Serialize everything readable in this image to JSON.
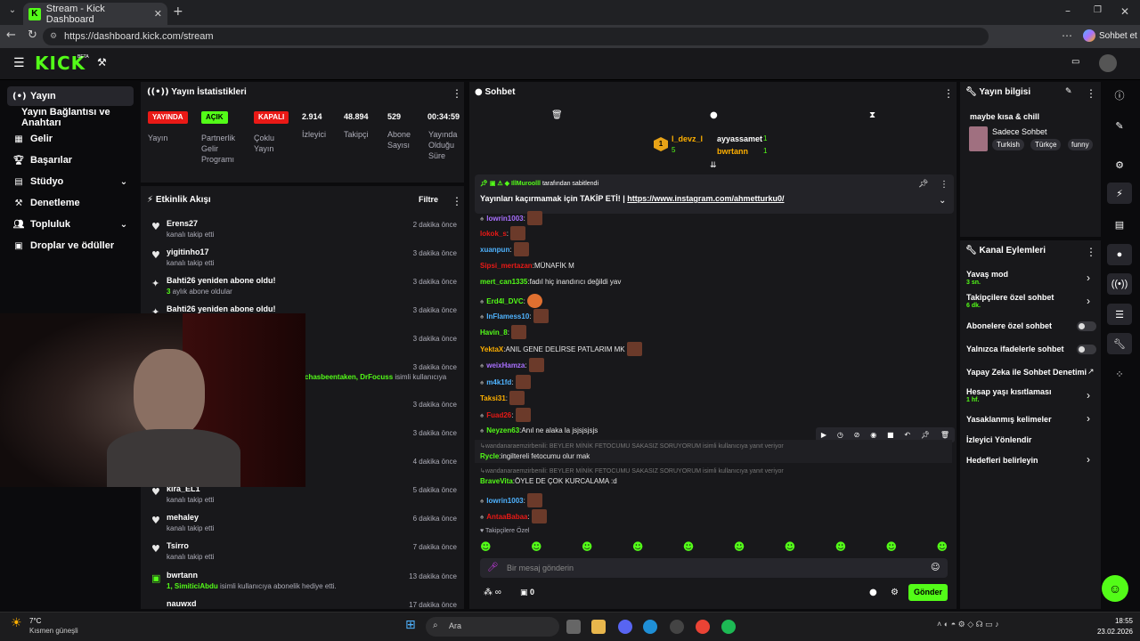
{
  "browser": {
    "tab_title": "Stream - Kick Dashboard",
    "url": "https://dashboard.kick.com/stream",
    "profile_label": "Sohbet et"
  },
  "header": {
    "logo": "KICK",
    "beta": "BETA"
  },
  "nav": {
    "items": [
      {
        "label": "Yayın",
        "icon": "broadcast-icon"
      },
      {
        "label": "Yayın Bağlantısı ve Anahtarı",
        "icon": ""
      },
      {
        "label": "Gelir",
        "icon": "revenue-icon"
      },
      {
        "label": "Başarılar",
        "icon": "trophy-icon"
      },
      {
        "label": "Stüdyo",
        "icon": "studio-icon"
      },
      {
        "label": "Denetleme",
        "icon": "moderation-icon"
      },
      {
        "label": "Topluluk",
        "icon": "community-icon"
      },
      {
        "label": "Droplar ve ödüller",
        "icon": "drops-icon"
      }
    ]
  },
  "stats": {
    "title": "Yayın İstatistikleri",
    "badges": [
      {
        "text": "YAYINDA",
        "label": "Yayın",
        "color": "#e91916"
      },
      {
        "text": "AÇIK",
        "label": "Partnerlik Gelir Programı",
        "color": "#53fc18"
      },
      {
        "text": "KAPALI",
        "label": "Çoklu Yayın",
        "color": "#e91916"
      }
    ],
    "values": [
      {
        "v": "2.914",
        "l": "İzleyici"
      },
      {
        "v": "48.894",
        "l": "Takipçi"
      },
      {
        "v": "529",
        "l": "Abone Sayısı"
      },
      {
        "v": "00:34:59",
        "l": "Yayında Olduğu Süre"
      }
    ]
  },
  "activity": {
    "title": "Etkinlik Akışı",
    "filter": "Filtre",
    "items": [
      {
        "name": "Erens27",
        "sub": "kanalı takip etti",
        "time": "2 dakika önce"
      },
      {
        "name": "yigitinho17",
        "sub": "kanalı takip etti",
        "time": "3 dakika önce"
      },
      {
        "name": "Bahti26 yeniden abone oldu!",
        "sub_num": "3",
        "sub": " aylık abone oldular",
        "time": "3 dakika önce"
      },
      {
        "name": "Bahti26 yeniden abone oldu!",
        "sub": "",
        "time": "3 dakika önce"
      },
      {
        "name": "",
        "sub": "",
        "time": "3 dakika önce"
      },
      {
        "name": "",
        "sub_hl": "chasbeentaken, DrFocuss",
        "sub": " isimli kullanıcıya",
        "time": "3 dakika önce"
      },
      {
        "name": "",
        "sub": "",
        "time": "3 dakika önce"
      },
      {
        "name": "",
        "sub": "",
        "time": "3 dakika önce"
      },
      {
        "name": "",
        "sub": "",
        "time": "4 dakika önce"
      },
      {
        "name": "kira_EL1",
        "sub": "kanalı takip etti",
        "time": "5 dakika önce"
      },
      {
        "name": "mehaley",
        "sub": "kanalı takip etti",
        "time": "6 dakika önce"
      },
      {
        "name": "Tsirro",
        "sub": "kanalı takip etti",
        "time": "7 dakika önce"
      },
      {
        "name": "bwrtann",
        "sub_hl": "1, SimiticiAbdu",
        "sub": " isimli kullanıcıya abonelik hediye etti.",
        "time": "13 dakika önce"
      },
      {
        "name": "nauwxd",
        "sub": "",
        "time": "17 dakika önce"
      }
    ]
  },
  "chat": {
    "title": "Sohbet",
    "top": {
      "first": "l_devz_l",
      "first_count": "5",
      "gifters": [
        {
          "name": "ayyassamet",
          "count": "1"
        },
        {
          "name": "bwrtann",
          "count": "1"
        }
      ]
    },
    "pinned": {
      "by": "IllMuroolll",
      "by_suffix": " tarafından sabitlendi",
      "text": "Yayınları kaçırmamak için TAKİP ETİ! | ",
      "link": "https://www.instagram.com/ahmetturku0/"
    },
    "messages": [
      {
        "user": "lowrin1003",
        "color": "#a970ff",
        "text": "",
        "emote": true
      },
      {
        "user": "lokok_s",
        "color": "#e91916",
        "text": "",
        "emote": true
      },
      {
        "user": "xuanpun",
        "color": "#4fb3ff",
        "text": "",
        "emote": true
      },
      {
        "user": "Sipsi_mertazan",
        "color": "#e91916",
        "text": " MÜNAFİK M",
        "emote": false
      },
      {
        "user": "mert_can1335",
        "color": "#53fc18",
        "text": " fadıl hiç inandırıcı değildi yav",
        "emote": false
      },
      {
        "user": "Erd4l_DVC",
        "color": "#53fc18",
        "text": "",
        "emote": true
      },
      {
        "user": "InFlamess10",
        "color": "#4fb3ff",
        "text": "",
        "emote": true
      },
      {
        "user": "Havin_8",
        "color": "#53fc18",
        "text": "",
        "emote": true
      },
      {
        "user": "YektaX",
        "color": "#ffb000",
        "text": " ANIL GENE DELİRSE PATLARIM MK",
        "emote": true
      },
      {
        "user": "weixHamza",
        "color": "#a970ff",
        "text": "",
        "emote": true
      },
      {
        "user": "m4k1fd",
        "color": "#4fb3ff",
        "text": "",
        "emote": true
      },
      {
        "user": "Taksi31",
        "color": "#ffb000",
        "text": "",
        "emote": true
      },
      {
        "user": "Fuad26",
        "color": "#e91916",
        "text": "",
        "emote": true
      },
      {
        "user": "Neyzen63",
        "color": "#53fc18",
        "text": " Anıl ne alaka la jsjsjsjsjs",
        "emote": false
      }
    ],
    "reply1": "wandanaraemzirbenili: BEYLER MİNİK FETOCUMU SAKASIZ SORUYORUM isimli kullanıcıya yanıt veriyor",
    "msg_rycle": {
      "user": "Rycle",
      "text": " ingiltereli fetocumu olur mak"
    },
    "reply2": "wandanaraemzirbenili: BEYLER MİNİK FETOCUMU SAKASIZ SORUYORUM isimli kullanıcıya yanıt veriyor",
    "msg_brave": {
      "user": "BraveVita",
      "text": " ÖYLE DE ÇOK KURCALAMA :d"
    },
    "msg_low": {
      "user": "lowrin1003"
    },
    "msg_ant": {
      "user": "AntaaBabaa"
    },
    "followers_only": "Takipçilere Özel",
    "placeholder": "Bir mesaj gönderin",
    "send": "Gönder",
    "points": "0"
  },
  "info": {
    "title": "Yayın bilgisi",
    "stream_title": "maybe kısa & chill",
    "category": "Sadece Sohbet",
    "tags": [
      "Turkish",
      "Türkçe",
      "funny"
    ]
  },
  "actions": {
    "title": "Kanal Eylemleri",
    "items": [
      {
        "label": "Yavaş mod",
        "sub": "3 sn.",
        "type": "chev"
      },
      {
        "label": "Takipçilere özel sohbet",
        "sub": "6 dk.",
        "type": "chev"
      },
      {
        "label": "Abonelere özel sohbet",
        "sub": "",
        "type": "toggle"
      },
      {
        "label": "Yalnızca ifadelerle sohbet",
        "sub": "",
        "type": "toggle"
      },
      {
        "label": "Yapay Zeka ile Sohbet Denetimi",
        "sub": "",
        "type": "ext"
      },
      {
        "label": "Hesap yaşı kısıtlaması",
        "sub": "1 hf.",
        "type": "chev"
      },
      {
        "label": "Yasaklanmış kelimeler",
        "sub": "",
        "type": "chev"
      },
      {
        "label": "İzleyici Yönlendir",
        "sub": "",
        "type": "none"
      },
      {
        "label": "Hedefleri belirleyin",
        "sub": "",
        "type": "chev"
      }
    ]
  },
  "taskbar": {
    "weather_temp": "7°C",
    "weather_desc": "Kısmen güneşli",
    "search": "Ara",
    "time": "18:55",
    "date": "23.02.2026"
  }
}
